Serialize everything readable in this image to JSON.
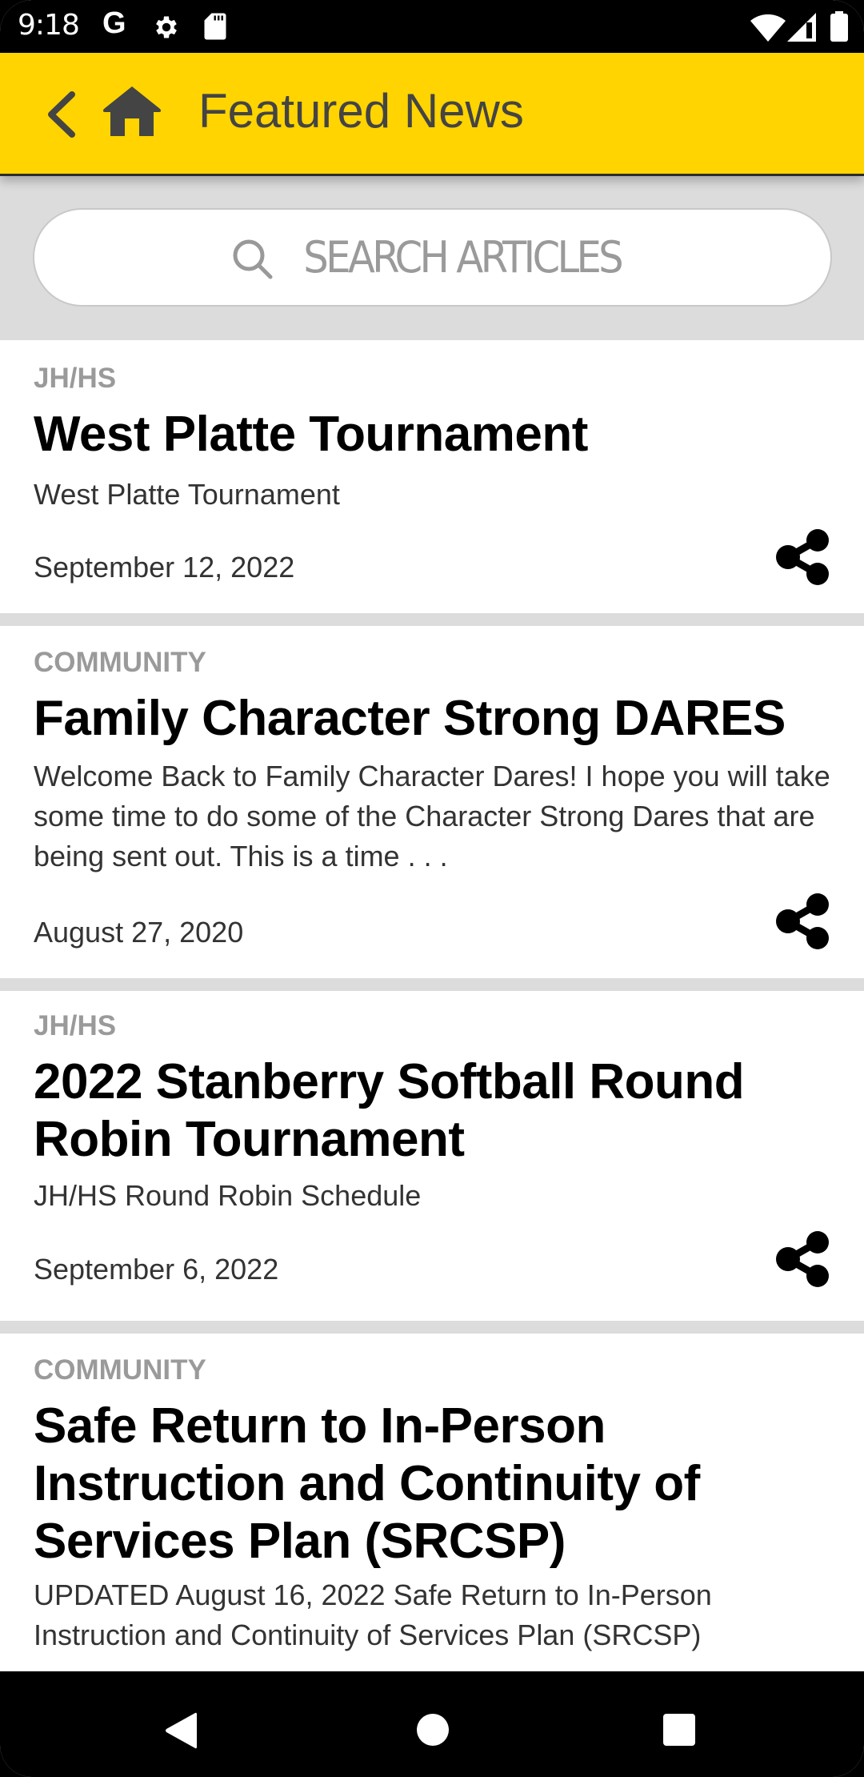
{
  "status_bar": {
    "time": "9:18",
    "left_icons": [
      "google-icon",
      "gear-icon",
      "sd-card-icon"
    ],
    "right_icons": [
      "wifi-icon",
      "signal-icon",
      "battery-icon"
    ],
    "google_glyph": "G"
  },
  "app_bar": {
    "title": "Featured News",
    "back_icon": "chevron-left-icon",
    "home_icon": "home-icon",
    "background_color": "#FFD400",
    "title_color": "#444444"
  },
  "search": {
    "placeholder": "SEARCH ARTICLES",
    "icon": "search-icon"
  },
  "articles": [
    {
      "category": "JH/HS",
      "title": "West Platte Tournament",
      "summary": "West Platte Tournament",
      "date": "September 12, 2022"
    },
    {
      "category": "COMMUNITY",
      "title": "Family Character Strong DARES",
      "summary": "Welcome Back to Family Character Dares!   I hope you will take some time to do some of the Character Strong Dares that are being sent out. This is a time . . .",
      "date": "August 27, 2020"
    },
    {
      "category": "JH/HS",
      "title": "2022 Stanberry Softball Round Robin Tournament",
      "summary": "JH/HS Round Robin Schedule",
      "date": "September 6, 2022"
    },
    {
      "category": "COMMUNITY",
      "title": "Safe Return to In-Person Instruction and Continuity of Services Plan (SRCSP)",
      "summary": "UPDATED  August 16, 2022 Safe Return to In-Person Instruction and Continuity of Services Plan (SRCSP)",
      "date": ""
    }
  ],
  "nav_bar": {
    "back": "back-triangle-icon",
    "home": "home-circle-icon",
    "recents": "recents-square-icon"
  }
}
